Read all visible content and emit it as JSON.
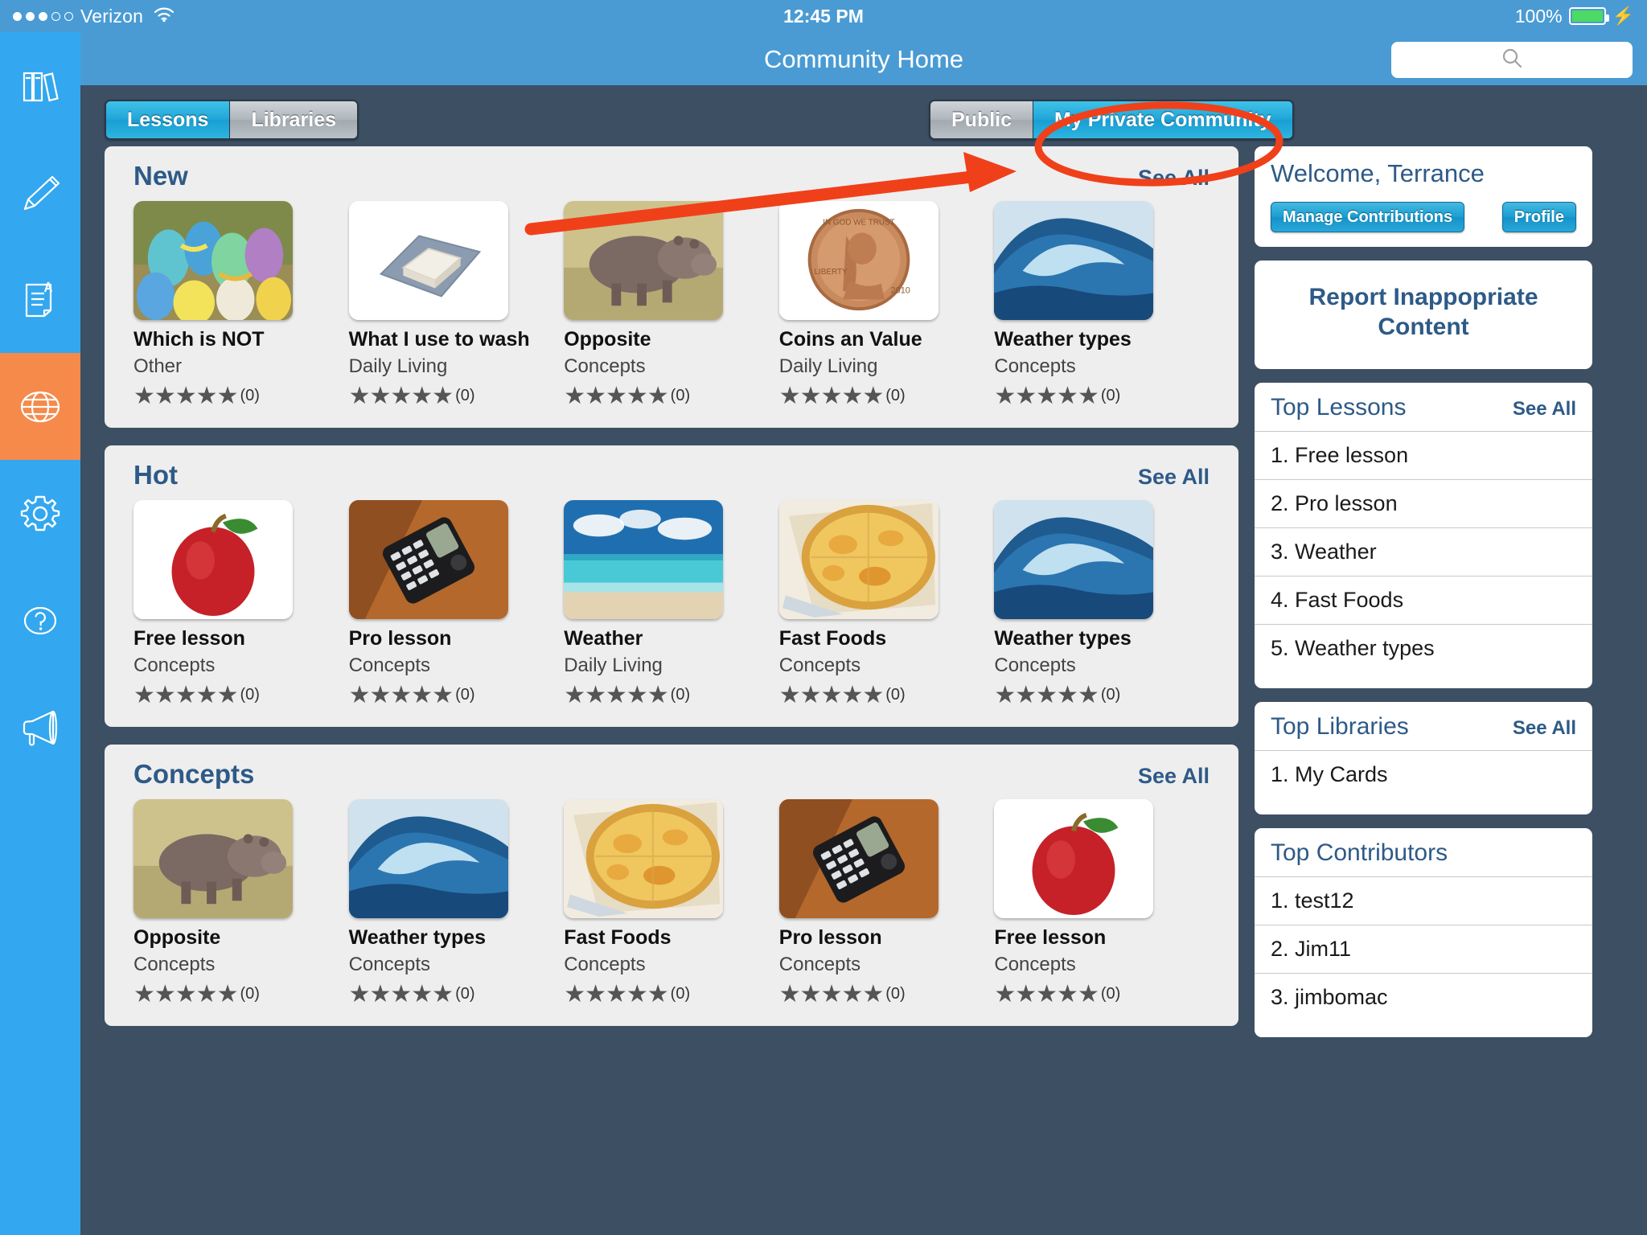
{
  "status_bar": {
    "carrier": "Verizon",
    "signal_dots_filled": 3,
    "signal_dots_total": 5,
    "wifi_icon": "wifi-icon",
    "time": "12:45 PM",
    "battery_percent": "100%",
    "charging_icon": "lightning-bolt-icon"
  },
  "sidebar": {
    "items": [
      {
        "name": "books-icon",
        "label": "Library"
      },
      {
        "name": "pencil-icon",
        "label": "Edit"
      },
      {
        "name": "document-a-icon",
        "label": "Documents"
      },
      {
        "name": "globe-icon",
        "label": "Community",
        "active": true
      },
      {
        "name": "gear-icon",
        "label": "Settings"
      },
      {
        "name": "question-mark-icon",
        "label": "Help"
      },
      {
        "name": "megaphone-icon",
        "label": "Announcements"
      }
    ]
  },
  "header": {
    "title": "Community Home",
    "search": {
      "placeholder": "",
      "value": "",
      "icon": "search-icon"
    }
  },
  "toolbar": {
    "left_segments": [
      {
        "label": "Lessons",
        "selected": true
      },
      {
        "label": "Libraries",
        "selected": false
      }
    ],
    "right_segments": [
      {
        "label": "Public",
        "selected": false
      },
      {
        "label": "My Private Community",
        "selected": true
      }
    ]
  },
  "annotation": {
    "highlight_color": "#f0401a",
    "target": "My Private Community"
  },
  "sections": [
    {
      "title": "New",
      "see_all": "See All",
      "cards": [
        {
          "title": "Which is NOT",
          "category": "Other",
          "rating": 0,
          "rating_label": "(0)",
          "art": "easter-eggs"
        },
        {
          "title": "What I use to wash",
          "category": "Daily Living",
          "rating": 0,
          "rating_label": "(0)",
          "art": "soap-cloth"
        },
        {
          "title": "Opposite",
          "category": "Concepts",
          "rating": 0,
          "rating_label": "(0)",
          "art": "hippo"
        },
        {
          "title": "Coins an Value",
          "category": "Daily Living",
          "rating": 0,
          "rating_label": "(0)",
          "art": "penny"
        },
        {
          "title": "Weather types",
          "category": "Concepts",
          "rating": 0,
          "rating_label": "(0)",
          "art": "wave"
        }
      ]
    },
    {
      "title": "Hot",
      "see_all": "See All",
      "cards": [
        {
          "title": "Free lesson",
          "category": "Concepts",
          "rating": 0,
          "rating_label": "(0)",
          "art": "apple"
        },
        {
          "title": "Pro lesson",
          "category": "Concepts",
          "rating": 0,
          "rating_label": "(0)",
          "art": "phone"
        },
        {
          "title": "Weather",
          "category": "Daily Living",
          "rating": 0,
          "rating_label": "(0)",
          "art": "beach"
        },
        {
          "title": "Fast Foods",
          "category": "Concepts",
          "rating": 0,
          "rating_label": "(0)",
          "art": "pizza"
        },
        {
          "title": "Weather types",
          "category": "Concepts",
          "rating": 0,
          "rating_label": "(0)",
          "art": "wave"
        }
      ]
    },
    {
      "title": "Concepts",
      "see_all": "See All",
      "cards": [
        {
          "title": "Opposite",
          "category": "Concepts",
          "rating": 0,
          "rating_label": "(0)",
          "art": "hippo"
        },
        {
          "title": "Weather types",
          "category": "Concepts",
          "rating": 0,
          "rating_label": "(0)",
          "art": "wave"
        },
        {
          "title": "Fast Foods",
          "category": "Concepts",
          "rating": 0,
          "rating_label": "(0)",
          "art": "pizza"
        },
        {
          "title": "Pro lesson",
          "category": "Concepts",
          "rating": 0,
          "rating_label": "(0)",
          "art": "phone"
        },
        {
          "title": "Free lesson",
          "category": "Concepts",
          "rating": 0,
          "rating_label": "(0)",
          "art": "apple"
        }
      ]
    }
  ],
  "rail": {
    "welcome": {
      "greeting": "Welcome, Terrance",
      "manage_label": "Manage Contributions",
      "profile_label": "Profile"
    },
    "report": {
      "text": "Report Inappopriate Content"
    },
    "top_lessons": {
      "title": "Top Lessons",
      "see_all": "See All",
      "items": [
        "1. Free lesson",
        "2. Pro lesson",
        "3. Weather",
        "4. Fast Foods",
        "5. Weather types"
      ]
    },
    "top_libraries": {
      "title": "Top Libraries",
      "see_all": "See All",
      "items": [
        "1. My Cards"
      ]
    },
    "top_contributors": {
      "title": "Top Contributors",
      "items": [
        "1. test12",
        "2. Jim11",
        "3. jimbomac"
      ]
    }
  }
}
